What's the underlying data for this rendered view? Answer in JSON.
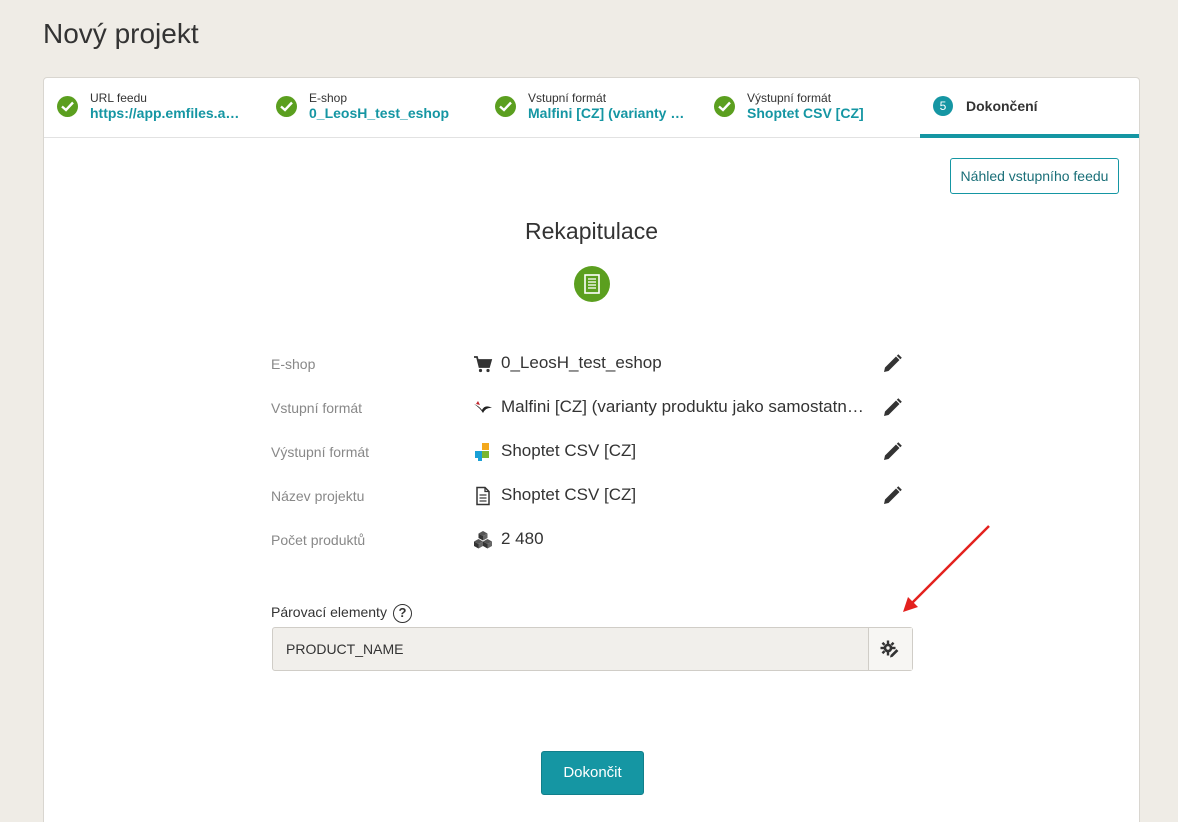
{
  "page": {
    "title": "Nový projekt"
  },
  "steps": [
    {
      "label": "URL feedu",
      "value": "https://app.emfiles.ap..."
    },
    {
      "label": "E-shop",
      "value": "0_LeosH_test_eshop"
    },
    {
      "label": "Vstupní formát",
      "value": "Malfini [CZ] (varianty p..."
    },
    {
      "label": "Výstupní formát",
      "value": "Shoptet CSV [CZ]"
    },
    {
      "number": "5",
      "label": "Dokončení"
    }
  ],
  "preview_button": "Náhled vstupního feedu",
  "recap": {
    "title": "Rekapitulace",
    "rows": [
      {
        "label": "E-shop",
        "icon": "cart-icon",
        "value": "0_LeosH_test_eshop"
      },
      {
        "label": "Vstupní formát",
        "icon": "malfini-logo-icon",
        "value": "Malfini [CZ] (varianty produktu jako samostatné produkty)"
      },
      {
        "label": "Výstupní formát",
        "icon": "shoptet-logo-icon",
        "value": "Shoptet CSV [CZ]"
      },
      {
        "label": "Název projektu",
        "icon": "document-icon",
        "value": "Shoptet CSV [CZ]"
      },
      {
        "label": "Počet produktů",
        "icon": "boxes-icon",
        "value": "2 480"
      }
    ]
  },
  "pairing": {
    "label": "Párovací elementy",
    "help": "?",
    "value": "PRODUCT_NAME"
  },
  "finish_button": "Dokončit",
  "colors": {
    "accent": "#1596a3",
    "success": "#5b9f1f",
    "annotation_arrow": "#e3211e"
  }
}
